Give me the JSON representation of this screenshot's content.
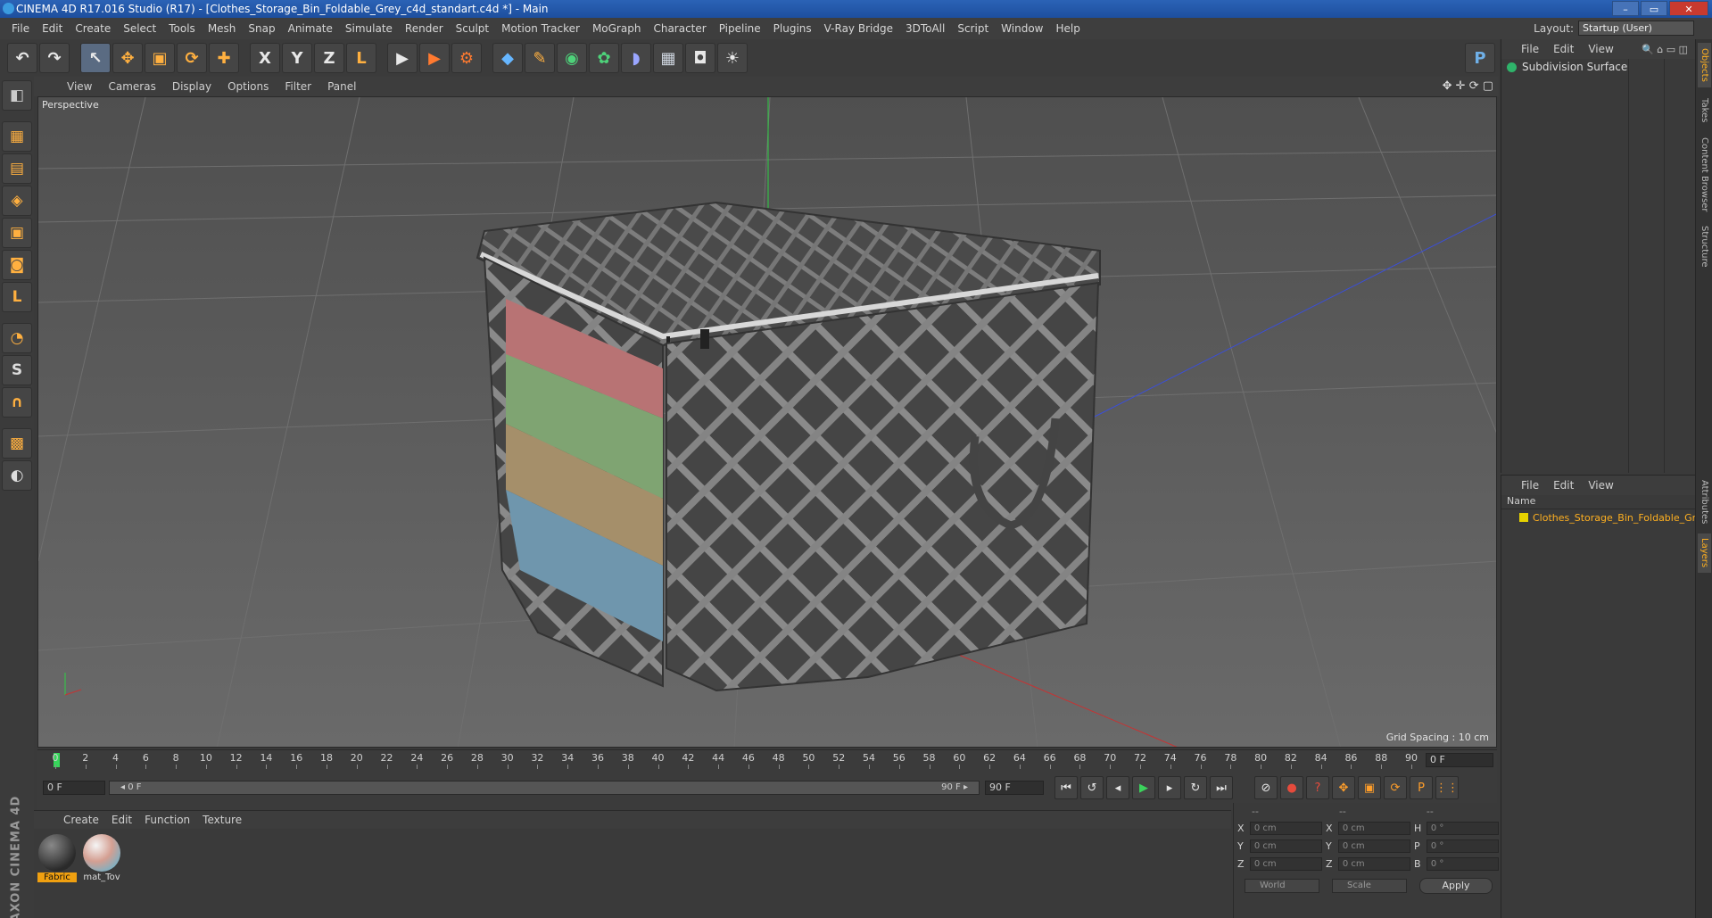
{
  "window": {
    "title": "CINEMA 4D R17.016 Studio (R17) - [Clothes_Storage_Bin_Foldable_Grey_c4d_standart.c4d *] - Main",
    "minimize": "–",
    "maximize": "▭",
    "close": "✕"
  },
  "menubar": [
    "File",
    "Edit",
    "Create",
    "Select",
    "Tools",
    "Mesh",
    "Snap",
    "Animate",
    "Simulate",
    "Render",
    "Sculpt",
    "Motion Tracker",
    "MoGraph",
    "Character",
    "Pipeline",
    "Plugins",
    "V-Ray Bridge",
    "3DToAll",
    "Script",
    "Window",
    "Help"
  ],
  "layout": {
    "label": "Layout:",
    "value": "Startup (User)"
  },
  "toolbar": {
    "undo": "↶",
    "redo": "↷",
    "select": "↖",
    "move": "✥",
    "scale": "▣",
    "rotate": "⟳",
    "transform": "✚",
    "x": "X",
    "y": "Y",
    "z": "Z",
    "coord": "L",
    "render_view": "▶",
    "render_picture": "▶",
    "render_settings": "⚙",
    "cube": "◆",
    "pen": "✎",
    "subdiv": "◉",
    "array": "✿",
    "deformer": "◗",
    "floor": "▦",
    "camera": "◘",
    "light": "☀",
    "python": "P"
  },
  "lefttools": [
    "◧",
    "▦",
    "▤",
    "◈",
    "▣",
    "◙",
    "L",
    "◔",
    "S",
    "∩",
    "▩",
    "◐"
  ],
  "viewport": {
    "menu": [
      "View",
      "Cameras",
      "Display",
      "Options",
      "Filter",
      "Panel"
    ],
    "nav_icons": "✥ ✛ ⟳ ▢",
    "label": "Perspective",
    "grid_spacing": "Grid Spacing : 10 cm"
  },
  "timeline": {
    "ticks": [
      "0",
      "2",
      "4",
      "6",
      "8",
      "10",
      "12",
      "14",
      "16",
      "18",
      "20",
      "22",
      "24",
      "26",
      "28",
      "30",
      "32",
      "34",
      "36",
      "38",
      "40",
      "42",
      "44",
      "46",
      "48",
      "50",
      "52",
      "54",
      "56",
      "58",
      "60",
      "62",
      "64",
      "66",
      "68",
      "70",
      "72",
      "74",
      "76",
      "78",
      "80",
      "82",
      "84",
      "86",
      "88",
      "90"
    ],
    "current_frame": "0 F"
  },
  "transport": {
    "start_field": "0 F",
    "range_start": "◂ 0 F",
    "range_end": "90 F ▸",
    "end_field": "90 F",
    "buttons": [
      "⏮",
      "↺",
      "◂",
      "▶",
      "▸",
      "↻",
      "⏭"
    ],
    "key_buttons": [
      "⊘",
      "●",
      "?",
      "✥",
      "▣",
      "⟳",
      "P",
      "⋮⋮"
    ]
  },
  "materials": {
    "menu": [
      "Create",
      "Edit",
      "Function",
      "Texture"
    ],
    "items": [
      {
        "name": "Fabric",
        "selected": true
      },
      {
        "name": "mat_Tov",
        "selected": false
      }
    ]
  },
  "coordinates": {
    "headers": [
      "--",
      "--",
      "--"
    ],
    "rows": [
      {
        "a": "X",
        "av": "0 cm",
        "b": "X",
        "bv": "0 cm",
        "c": "H",
        "cv": "0 °"
      },
      {
        "a": "Y",
        "av": "0 cm",
        "b": "Y",
        "bv": "0 cm",
        "c": "P",
        "cv": "0 °"
      },
      {
        "a": "Z",
        "av": "0 cm",
        "b": "Z",
        "bv": "0 cm",
        "c": "B",
        "cv": "0 °"
      }
    ],
    "world": "World",
    "scale": "Scale",
    "apply": "Apply"
  },
  "objects": {
    "menu": [
      "File",
      "Edit",
      "View"
    ],
    "icons": "🔍 ⌂ ▭ ◫",
    "items": [
      {
        "name": "Subdivision Surface"
      }
    ]
  },
  "layers": {
    "menu": [
      "File",
      "Edit",
      "View"
    ],
    "header": "Name",
    "items": [
      {
        "name": "Clothes_Storage_Bin_Foldable_Grey"
      }
    ]
  },
  "side_tabs": [
    "Objects",
    "Takes",
    "Content Browser",
    "Structure",
    "Attributes",
    "Layers"
  ],
  "logo": "MAXON CINEMA 4D"
}
